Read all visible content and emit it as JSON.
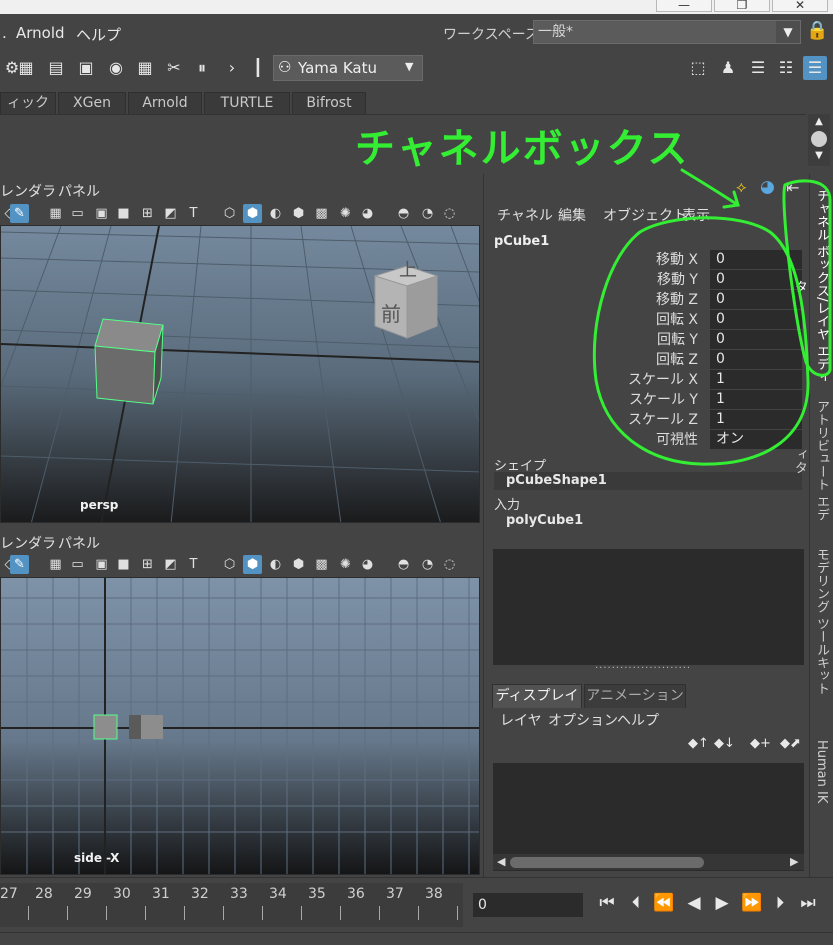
{
  "menubar": {
    "items": [
      "Arnold",
      "ヘルプ"
    ],
    "workspace_label": "ワークスペース:",
    "workspace_value": "一般*"
  },
  "statusline": {
    "user_name": "Yama Katu"
  },
  "shelf_tabs": [
    "ィックス",
    "XGen",
    "Arnold",
    "TURTLE",
    "Bifrost"
  ],
  "annotation": {
    "title": "チャネルボックス",
    "color": "#33ee33"
  },
  "viewport_top": {
    "menu": [
      "レンダラ",
      "パネル"
    ],
    "camera_label": "persp",
    "view_cube_top": "上",
    "view_cube_front": "前"
  },
  "viewport_bottom": {
    "menu": [
      "レンダラ",
      "パネル"
    ],
    "camera_label": "side -X"
  },
  "channel_box": {
    "menu": [
      "チャネル",
      "編集",
      "オブジェクト",
      "表示"
    ],
    "object_name": "pCube1",
    "channels": [
      {
        "label": "移動 X",
        "value": "0"
      },
      {
        "label": "移動 Y",
        "value": "0"
      },
      {
        "label": "移動 Z",
        "value": "0"
      },
      {
        "label": "回転 X",
        "value": "0"
      },
      {
        "label": "回転 Y",
        "value": "0"
      },
      {
        "label": "回転 Z",
        "value": "0"
      },
      {
        "label": "スケール X",
        "value": "1"
      },
      {
        "label": "スケール Y",
        "value": "1"
      },
      {
        "label": "スケール Z",
        "value": "1"
      },
      {
        "label": "可視性",
        "value": "オン"
      }
    ],
    "shapes_header": "シェイプ",
    "shape_name": "pCubeShape1",
    "inputs_header": "入力",
    "input_name": "polyCube1"
  },
  "layer_editor": {
    "tabs": [
      "ディスプレイ",
      "アニメーション"
    ],
    "menu": [
      "レイヤ",
      "オプション",
      "ヘルプ"
    ]
  },
  "side_tabs": [
    "チャネル ボックス/レイヤ エディタ",
    "アトリビュート エディタ",
    "モデリング ツールキット",
    "Human IK"
  ],
  "time_slider": {
    "ticks": [
      "27",
      "28",
      "29",
      "30",
      "31",
      "32",
      "33",
      "34",
      "35",
      "36",
      "37",
      "38"
    ],
    "current_frame": "0"
  }
}
